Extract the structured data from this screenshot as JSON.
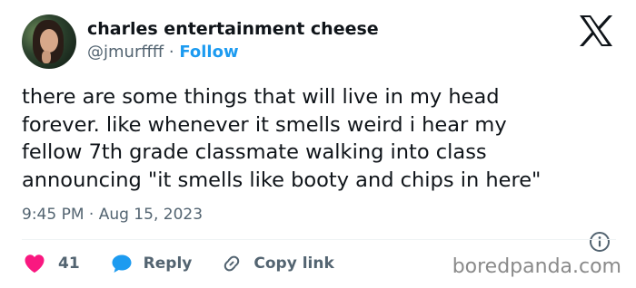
{
  "author": {
    "name": "charles entertainment cheese",
    "handle": "@jmurffff",
    "separator": " · ",
    "follow_label": "Follow"
  },
  "tweet": {
    "text": "there are some things that will live in my head\nforever. like whenever it smells weird i hear my\nfellow 7th grade classmate walking into class\nannouncing \"it smells like booty and chips in here\"",
    "timestamp": "9:45 PM · Aug 15, 2023"
  },
  "actions": {
    "like_count": "41",
    "reply_label": "Reply",
    "copy_link_label": "Copy link"
  },
  "watermark": "boredpanda.com",
  "icons": {
    "brand": "x-logo-icon",
    "like": "heart-icon",
    "reply": "speech-bubble-icon",
    "copy": "link-icon",
    "info": "info-icon"
  },
  "colors": {
    "text": "#0f1419",
    "secondary": "#536471",
    "accent": "#1d9bf0",
    "like": "#f91880"
  }
}
